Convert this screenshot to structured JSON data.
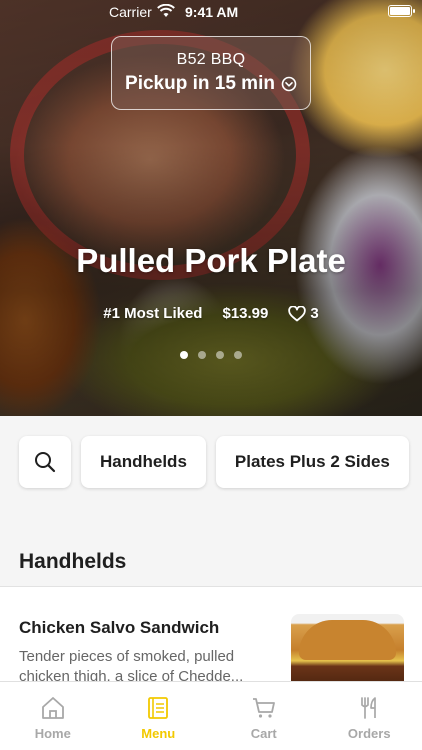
{
  "status_bar": {
    "carrier": "Carrier",
    "time": "9:41 AM"
  },
  "store": {
    "name": "B52 BBQ",
    "pickup": "Pickup in 15 min"
  },
  "hero": {
    "title": "Pulled Pork Plate",
    "rank": "#1 Most Liked",
    "price": "$13.99",
    "likes": "3",
    "slides_count": 4,
    "active_slide": 1
  },
  "chips": {
    "handhelds": "Handhelds",
    "plates": "Plates Plus 2 Sides"
  },
  "section": {
    "title": "Handhelds"
  },
  "item": {
    "name": "Chicken Salvo Sandwich",
    "description": "Tender pieces of smoked, pulled chicken thigh, a slice of Chedde..."
  },
  "tabs": [
    {
      "label": "Home",
      "icon": "home-icon"
    },
    {
      "label": "Menu",
      "icon": "menu-book-icon"
    },
    {
      "label": "Cart",
      "icon": "cart-icon"
    },
    {
      "label": "Orders",
      "icon": "fork-knife-icon"
    }
  ],
  "colors": {
    "accent": "#f2c900",
    "inactive_tab": "#a8a8a8",
    "white": "#ffffff"
  }
}
